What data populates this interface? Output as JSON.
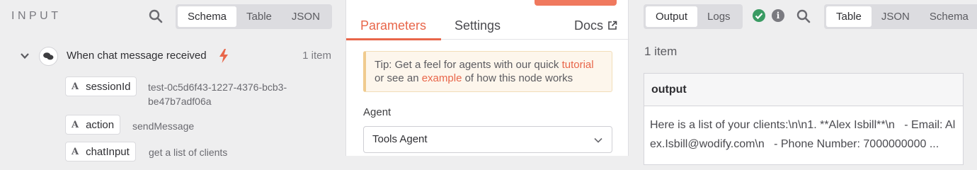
{
  "input_panel": {
    "title": "INPUT",
    "view_modes": [
      "Schema",
      "Table",
      "JSON"
    ],
    "node": {
      "name": "When chat message received",
      "item_count": "1 item"
    },
    "fields": [
      {
        "type": "A",
        "name": "sessionId",
        "value": "test-0c5d6f43-1227-4376-bcb3-be47b7adf06a"
      },
      {
        "type": "A",
        "name": "action",
        "value": "sendMessage"
      },
      {
        "type": "A",
        "name": "chatInput",
        "value": "get a list of clients"
      }
    ]
  },
  "node_panel": {
    "tabs": {
      "parameters": "Parameters",
      "settings": "Settings",
      "docs": "Docs"
    },
    "tip": {
      "text1": "Tip: Get a feel for agents with our quick ",
      "link1": "tutorial",
      "text2": "or see an ",
      "link2": "example",
      "text3": " of how this node works"
    },
    "agent_label": "Agent",
    "agent_value": "Tools Agent"
  },
  "output_panel": {
    "modes": [
      "Output",
      "Logs"
    ],
    "view_modes": [
      "Table",
      "JSON",
      "Schema"
    ],
    "item_count": "1 item",
    "column": "output",
    "value": "Here is a list of your clients:\\n\\n1. **Alex Isbill**\\n   - Email: Alex.Isbill@wodify.com\\n   - Phone Number: 7000000000 ..."
  },
  "colors": {
    "accent": "#e8664a",
    "success": "#3a9b63"
  }
}
